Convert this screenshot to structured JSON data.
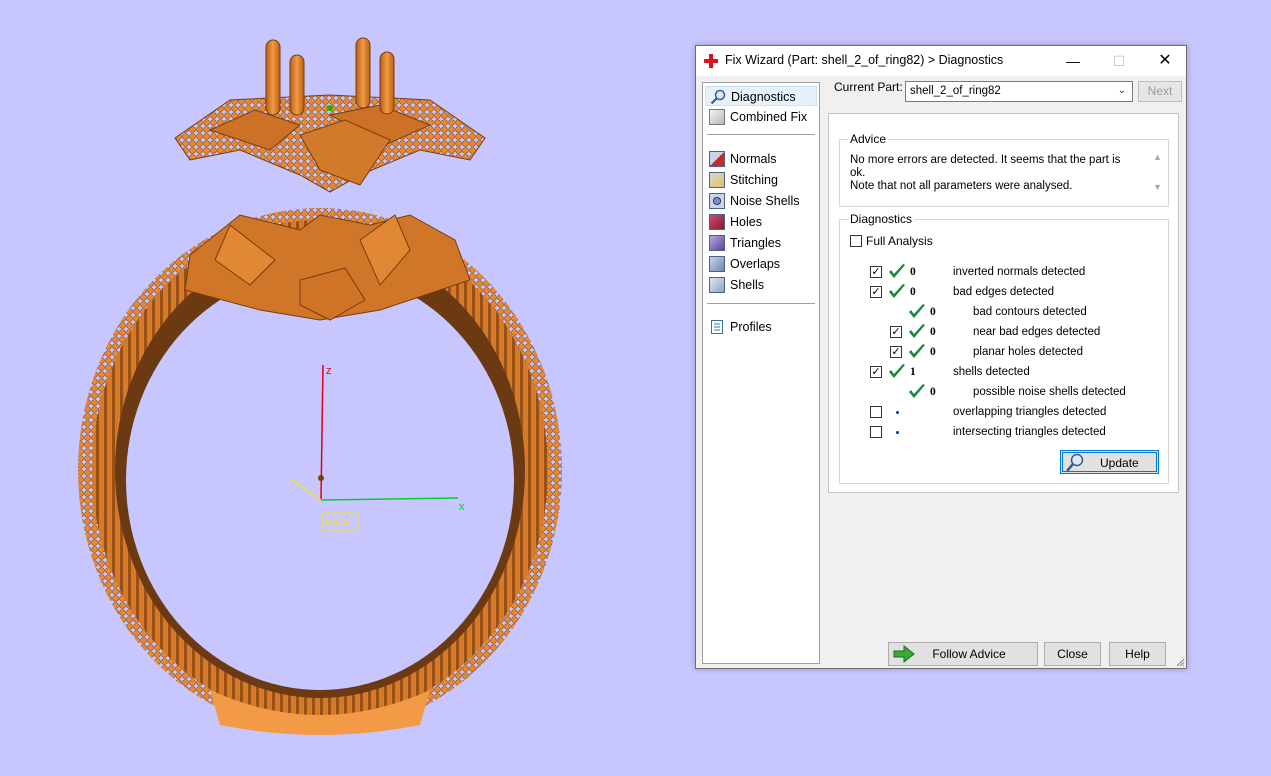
{
  "window": {
    "title": "Fix Wizard (Part: shell_2_of_ring82) > Diagnostics",
    "minimize_glyph": "—",
    "maximize_glyph": "☐",
    "close_glyph": "✕"
  },
  "viewport": {
    "axis_z": "z",
    "axis_x": "x",
    "wcs_label": "WCS",
    "colors": {
      "background": "#c8c6fe",
      "ring": "#e8892e",
      "z_axis": "#e0001b",
      "x_axis": "#00d02a"
    }
  },
  "sidebar": {
    "items": [
      {
        "label": "Diagnostics",
        "icon": "magnifier-icon",
        "selected": true
      },
      {
        "label": "Combined Fix",
        "icon": "cube-icon"
      },
      {
        "label": "Normals",
        "icon": "normals-cube-icon"
      },
      {
        "label": "Stitching",
        "icon": "stitching-cube-icon"
      },
      {
        "label": "Noise Shells",
        "icon": "noise-shells-icon"
      },
      {
        "label": "Holes",
        "icon": "holes-cube-icon"
      },
      {
        "label": "Triangles",
        "icon": "triangles-cube-icon"
      },
      {
        "label": "Overlaps",
        "icon": "overlaps-cube-icon"
      },
      {
        "label": "Shells",
        "icon": "shells-cube-icon"
      },
      {
        "label": "Profiles",
        "icon": "document-icon"
      }
    ]
  },
  "current_part": {
    "label": "Current Part:",
    "value": "shell_2_of_ring82",
    "next_label": "Next"
  },
  "advice": {
    "title": "Advice",
    "text_line1": "No more errors are detected. It seems that the part is ok.",
    "text_line2": "Note that not all parameters were analysed."
  },
  "diagnostics": {
    "title": "Diagnostics",
    "full_analysis_label": "Full Analysis",
    "full_analysis_checked": false,
    "rows": [
      {
        "checked": true,
        "status": "ok",
        "count": "0",
        "label": "inverted normals detected",
        "indent": 0,
        "has_checkbox": true
      },
      {
        "checked": true,
        "status": "ok",
        "count": "0",
        "label": "bad edges detected",
        "indent": 0,
        "has_checkbox": true
      },
      {
        "checked": false,
        "status": "ok",
        "count": "0",
        "label": "bad contours detected",
        "indent": 1,
        "has_checkbox": false
      },
      {
        "checked": true,
        "status": "ok",
        "count": "0",
        "label": "near bad edges detected",
        "indent": 1,
        "has_checkbox": true
      },
      {
        "checked": true,
        "status": "ok",
        "count": "0",
        "label": "planar holes detected",
        "indent": 1,
        "has_checkbox": true
      },
      {
        "checked": true,
        "status": "ok",
        "count": "1",
        "label": "shells detected",
        "indent": 0,
        "has_checkbox": true
      },
      {
        "checked": false,
        "status": "ok",
        "count": "0",
        "label": "possible noise shells detected",
        "indent": 1,
        "has_checkbox": false
      },
      {
        "checked": false,
        "status": "pending",
        "count": "",
        "label": "overlapping triangles detected",
        "indent": 0,
        "has_checkbox": true
      },
      {
        "checked": false,
        "status": "pending",
        "count": "",
        "label": "intersecting triangles detected",
        "indent": 0,
        "has_checkbox": true
      }
    ],
    "update_label": "Update"
  },
  "buttons": {
    "follow_advice": "Follow Advice",
    "close": "Close",
    "help": "Help"
  }
}
